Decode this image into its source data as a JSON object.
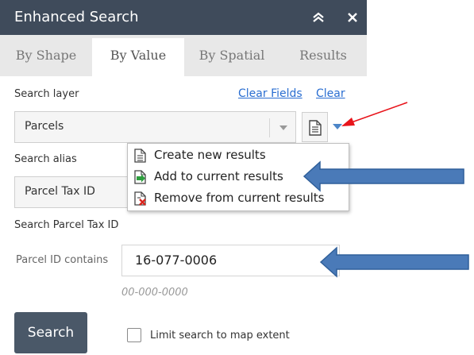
{
  "window": {
    "title": "Enhanced Search"
  },
  "tabs": [
    {
      "label": "By Shape",
      "active": false
    },
    {
      "label": "By Value",
      "active": true
    },
    {
      "label": "By Spatial",
      "active": false
    },
    {
      "label": "Results",
      "active": false
    }
  ],
  "form": {
    "search_layer_label": "Search layer",
    "clear_fields_link": "Clear Fields",
    "clear_link": "Clear",
    "layer_select_value": "Parcels",
    "search_alias_label": "Search alias",
    "alias_select_value": "Parcel Tax ID",
    "search_heading": "Search Parcel Tax ID",
    "field_label": "Parcel ID contains",
    "field_value": "16-077-0006",
    "field_hint": "00-000-0000",
    "search_button": "Search",
    "limit_extent_label": "Limit search to map extent",
    "limit_extent_checked": false
  },
  "results_menu": {
    "items": [
      {
        "label": "Create new results",
        "icon": "document-icon"
      },
      {
        "label": "Add to current results",
        "icon": "add-document-icon"
      },
      {
        "label": "Remove from current results",
        "icon": "remove-document-icon"
      }
    ]
  },
  "colors": {
    "titlebar": "#3f4b5b",
    "link": "#2a6ed1",
    "annotation_arrow_red": "#e8141b",
    "annotation_arrow_blue": "#4a7ab8"
  }
}
